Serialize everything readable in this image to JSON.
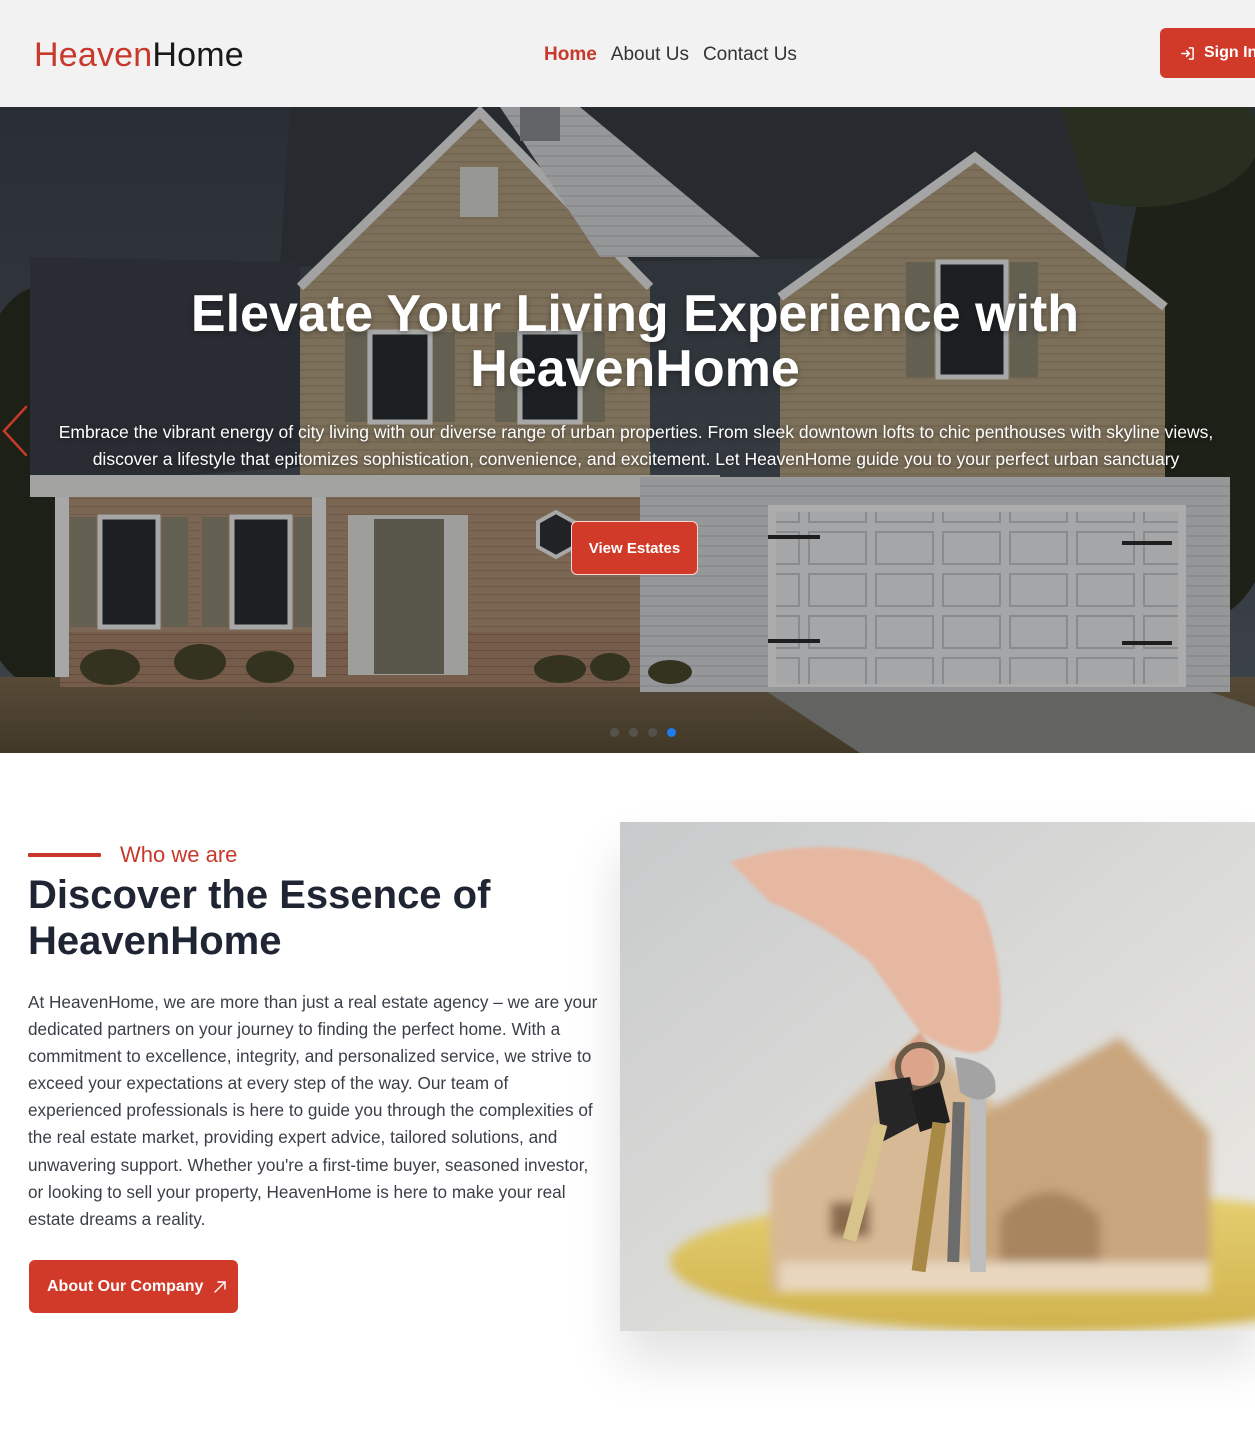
{
  "navbar": {
    "brand_part1": "Heaven",
    "brand_part2": "Home",
    "links": [
      {
        "label": "Home",
        "active": true
      },
      {
        "label": "About Us",
        "active": false
      },
      {
        "label": "Contact Us",
        "active": false
      }
    ],
    "signin_label": "Sign In",
    "signin_icon": "sign-in-icon"
  },
  "hero": {
    "title": "Elevate Your Living Experience with HeavenHome",
    "subtitle": "Embrace the vibrant energy of city living with our diverse range of urban properties. From sleek downtown lofts to chic penthouses with skyline views, discover a lifestyle that epitomizes sophistication, convenience, and excitement. Let HeavenHome guide you to your perfect urban sanctuary",
    "button_label": "View Estates",
    "prev_icon": "chevron-left-icon",
    "slides_count": 4,
    "active_slide": 4
  },
  "about": {
    "eyebrow": "Who we are",
    "title": "Discover the Essence of HeavenHome",
    "text": "At HeavenHome, we are more than just a real estate agency – we are your dedicated partners on your journey to finding the perfect home. With a commitment to excellence, integrity, and personalized service, we strive to exceed your expectations at every step of the way. Our team of experienced professionals is here to guide you through the complexities of the real estate market, providing expert advice, tailored solutions, and unwavering support. Whether you're a first-time buyer, seasoned investor, or looking to sell your property, HeavenHome is here to make your real estate dreams a reality.",
    "button_label": "About Our Company",
    "button_icon": "arrow-up-right-icon"
  },
  "colors": {
    "accent": "#d13a29",
    "brand_red": "#c8392b",
    "dot_active": "#1e7bf0"
  }
}
